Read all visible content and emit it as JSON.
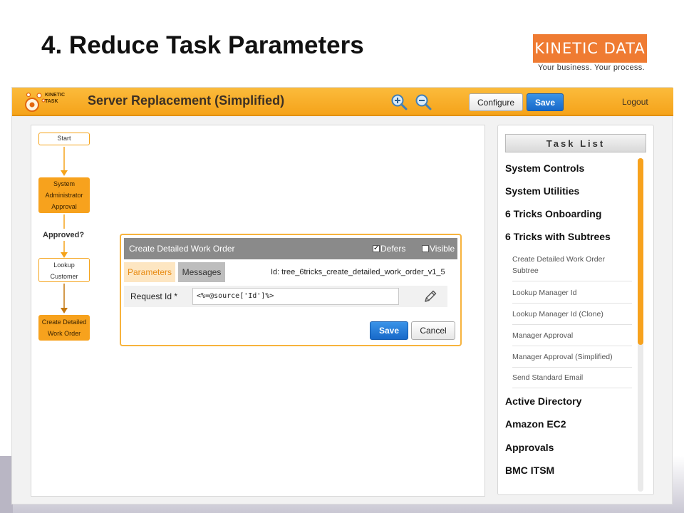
{
  "slide": {
    "title": "4. Reduce Task Parameters",
    "logo": {
      "name": "KINETIC DATA",
      "tagline": "Your business. Your process.",
      "color": "#ef7b32"
    }
  },
  "header": {
    "logo_line1": "KINETIC",
    "logo_line2": "TASK",
    "title": "Server Replacement (Simplified)",
    "zoom_in_icon": "zoom-in-icon",
    "zoom_out_icon": "zoom-out-icon",
    "configure_label": "Configure",
    "save_label": "Save",
    "logout_label": "Logout",
    "accent_color": "#f5a31a"
  },
  "workflow": {
    "nodes": {
      "start": "Start",
      "system_admin": [
        "System",
        "Administrator",
        "Approval"
      ],
      "lookup": [
        "Lookup",
        "Customer"
      ],
      "create": [
        "Create Detailed",
        "Work Order"
      ]
    },
    "connector_label": "Approved?"
  },
  "dialog": {
    "title": "Create Detailed Work Order",
    "defers_label": "Defers",
    "defers_checked": true,
    "visible_label": "Visible",
    "visible_checked": false,
    "tabs": {
      "parameters": "Parameters",
      "messages": "Messages"
    },
    "id_text": "Id: tree_6tricks_create_detailed_work_order_v1_5",
    "param_label": "Request Id *",
    "param_value": "<%=@source['Id']%>",
    "edit_icon": "pencil-icon",
    "save_label": "Save",
    "cancel_label": "Cancel"
  },
  "tasklist": {
    "header": "Task List",
    "categories_top": [
      "System Controls",
      "System Utilities",
      "6 Tricks Onboarding",
      "6 Tricks with Subtrees"
    ],
    "subitems": [
      "Create Detailed Work Order Subtree",
      "Lookup Manager Id",
      "Lookup Manager Id (Clone)",
      "Manager Approval",
      "Manager Approval (Simplified)",
      "Send Standard Email"
    ],
    "categories_bottom": [
      "Active Directory",
      "Amazon EC2",
      "Approvals",
      "BMC ITSM"
    ]
  }
}
